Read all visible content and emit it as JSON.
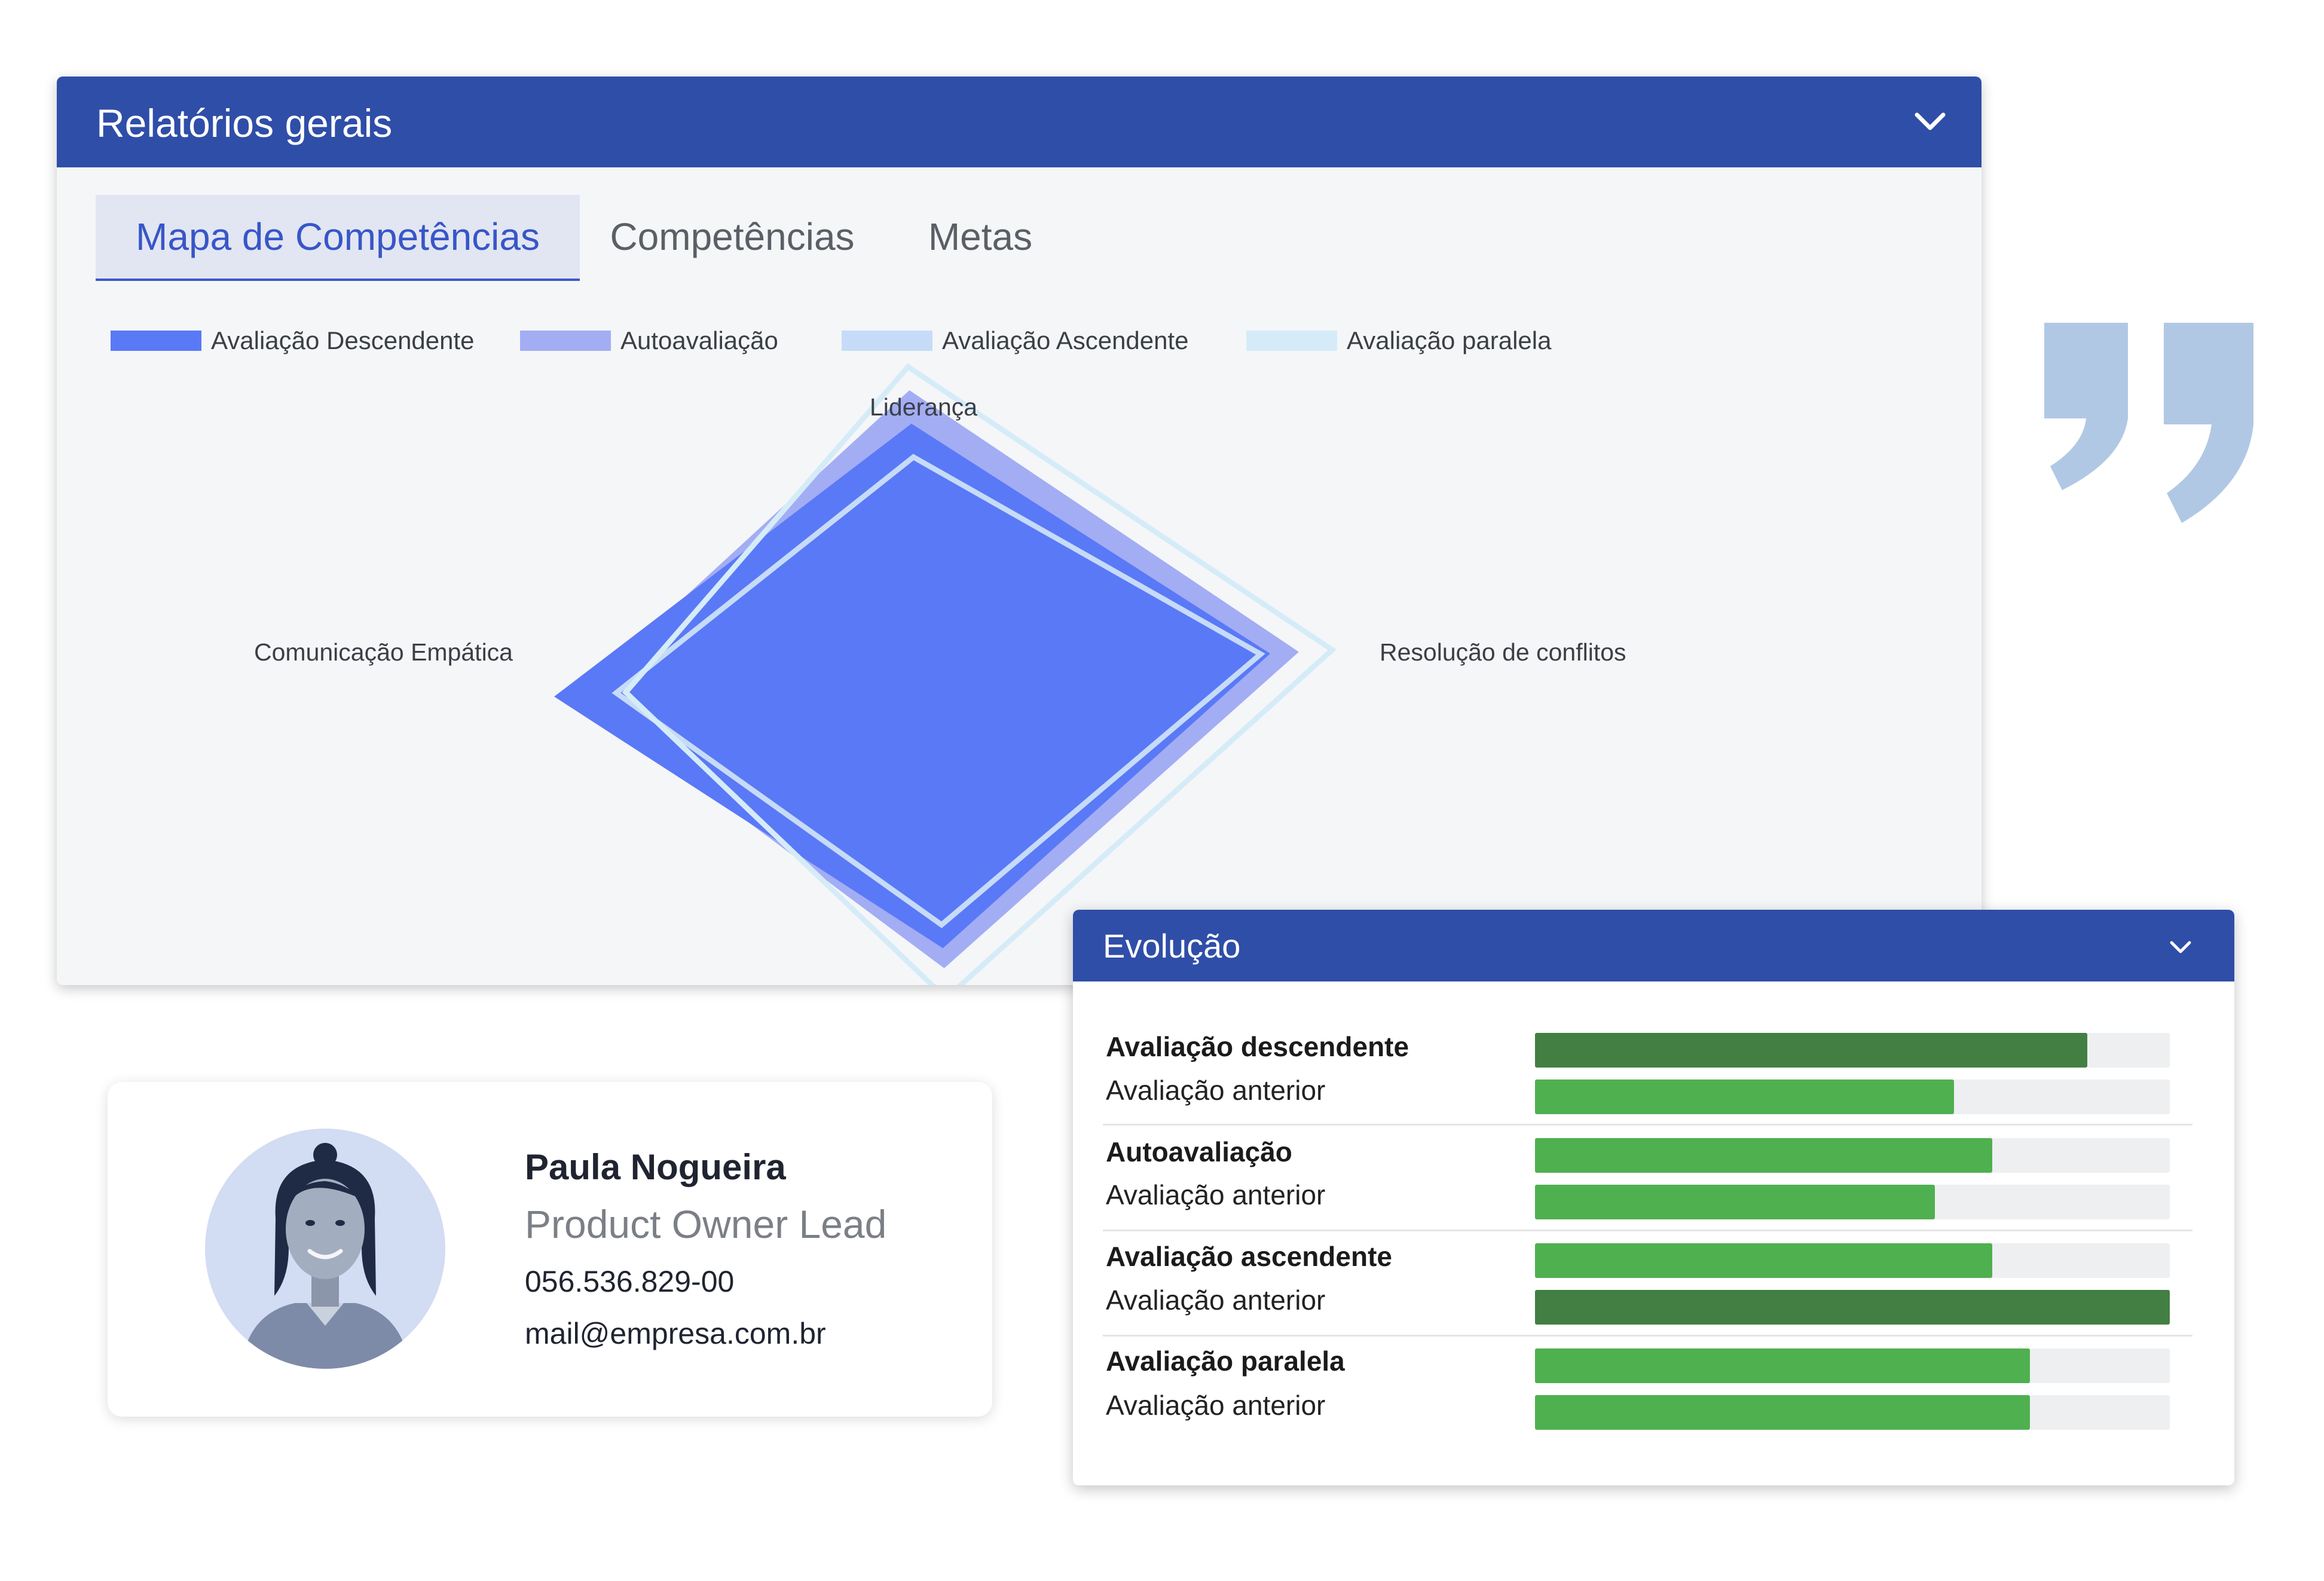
{
  "reports": {
    "title": "Relatórios gerais",
    "tabs": [
      {
        "label": "Mapa de Competências",
        "active": true
      },
      {
        "label": "Competências",
        "active": false
      },
      {
        "label": "Metas",
        "active": false
      }
    ]
  },
  "chart_data": {
    "type": "radar",
    "axes": [
      "Liderança",
      "Resolução de conflitos",
      "",
      "Comunicação Empática"
    ],
    "legend": [
      {
        "name": "Avaliação Descendente",
        "color": "#5a79f7"
      },
      {
        "name": "Autoavaliação",
        "color": "#a3adf4"
      },
      {
        "name": "Avaliação Ascendente",
        "color": "#c6dbf7"
      },
      {
        "name": "Avaliação paralela",
        "color": "#d5ecf8"
      }
    ],
    "series": [
      {
        "name": "Autoavaliação",
        "values": [
          0.85,
          0.78,
          0.88,
          0.73
        ],
        "style": "fill",
        "color": "#a3adf4"
      },
      {
        "name": "Avaliação Descendente",
        "values": [
          0.75,
          0.72,
          0.82,
          0.78
        ],
        "style": "fill",
        "color": "#5a79f7"
      },
      {
        "name": "Avaliação Ascendente",
        "values": [
          0.65,
          0.7,
          0.75,
          0.65
        ],
        "style": "line",
        "color": "#c6dbf7"
      },
      {
        "name": "Avaliação paralela",
        "values": [
          0.92,
          0.85,
          0.97,
          0.63
        ],
        "style": "line",
        "color": "#d5ecf8"
      }
    ],
    "grid": false,
    "legend_position": "top-left"
  },
  "evolution": {
    "title": "Evolução",
    "groups": [
      {
        "label": "Avaliação descendente",
        "value": 0.87,
        "color": "#437f43",
        "previous_label": "Avaliação anterior",
        "previous_value": 0.66,
        "previous_color": "#4fb04f"
      },
      {
        "label": "Autoavaliação",
        "value": 0.72,
        "color": "#4fb04f",
        "previous_label": "Avaliação anterior",
        "previous_value": 0.63,
        "previous_color": "#4fb04f"
      },
      {
        "label": "Avaliação ascendente",
        "value": 0.72,
        "color": "#4fb04f",
        "previous_label": "Avaliação anterior",
        "previous_value": 1.0,
        "previous_color": "#437f43"
      },
      {
        "label": "Avaliação paralela",
        "value": 0.78,
        "color": "#4fb04f",
        "previous_label": "Avaliação anterior",
        "previous_value": 0.78,
        "previous_color": "#4fb04f"
      }
    ]
  },
  "profile": {
    "name": "Paula Nogueira",
    "role": "Product Owner Lead",
    "document": "056.536.829-00",
    "email": "mail@empresa.com.br"
  },
  "decor": {
    "quote_icon": "closing-quote-icon",
    "quote_color": "#b1c8e4"
  }
}
